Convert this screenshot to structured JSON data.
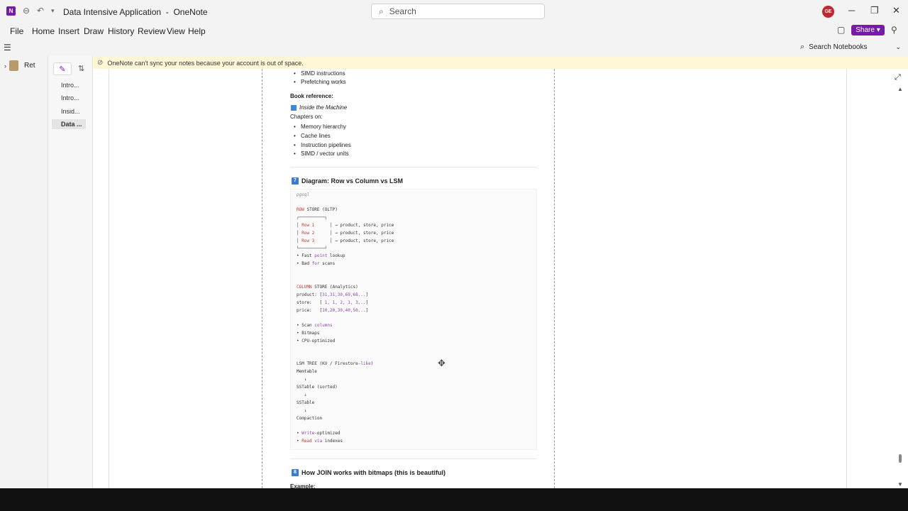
{
  "window": {
    "title": "Data Intensive Application",
    "app_name": "OneNote",
    "title_separator": "-",
    "search_placeholder": "Search",
    "avatar_initials": "GE"
  },
  "menu": {
    "items": [
      "File",
      "Home",
      "Insert",
      "Draw",
      "History",
      "Review",
      "View",
      "Help"
    ],
    "share_label": "Share"
  },
  "subbar": {
    "search_notebooks_placeholder": "Search Notebooks"
  },
  "sidebar": {
    "notebook_label": "Ret",
    "pages": [
      "Intro...",
      "Intro...",
      "Insid...",
      "Data ..."
    ],
    "active_page_index": 3
  },
  "notification": {
    "text": "OneNote can't sync your notes because your account is out of space."
  },
  "note": {
    "top_bullets": [
      "SIMD instructions",
      "Prefetching works"
    ],
    "book_reference_label": "Book reference:",
    "book_title": "Inside the Machine",
    "chapters_label": "Chapters on:",
    "chapters": [
      "Memory hierarchy",
      "Cache lines",
      "Instruction pipelines",
      "SIMD / vector units"
    ],
    "section7_badge": "7",
    "section7_title": "Diagram: Row vs Column vs LSM",
    "code_lang": "pgsql",
    "section8_badge": "8",
    "section8_title": "How JOIN works with bitmaps (this is beautiful)",
    "example_label": "Example:"
  },
  "code": {
    "row_store_kw": "ROW",
    "row_store_title": " STORE (OLTP)",
    "box_top": "┌──────────┐",
    "rows": [
      {
        "label": "Row 1",
        "desc": "→ product, store, price"
      },
      {
        "label": "Row 2",
        "desc": "→ product, store, price"
      },
      {
        "label": "Row 3",
        "desc": "→ product, store, price"
      }
    ],
    "box_bottom": "└──────────┘",
    "row_bullet1_pre": "• Fast ",
    "row_bullet1_kw": "point",
    "row_bullet1_post": " lookup",
    "row_bullet2_pre": "• Bad ",
    "row_bullet2_kw": "for",
    "row_bullet2_post": " scans",
    "col_store_kw": "COLUMN",
    "col_store_title": " STORE (Analytics)",
    "col_product_label": "product: [",
    "col_product_vals": "31,31,30,69,68...",
    "col_store_label": "store:   [",
    "col_store_vals": " 1, 1, 2, 1, 3...",
    "col_price_label": "price:   [",
    "col_price_vals": "10,20,30,40,50...",
    "col_close": "]",
    "col_bullet1_pre": "• Scan ",
    "col_bullet1_kw": "columns",
    "col_bullet2": "• Bitmaps",
    "col_bullet3": "• CPU-optimized",
    "lsm_title_pre": "LSM TREE (KV / Firestore-",
    "lsm_title_kw": "like",
    "lsm_title_post": ")",
    "lsm_memtable": "Memtable",
    "lsm_arrow": "   ↓",
    "lsm_sstable_sorted": "SSTable (sorted)",
    "lsm_sstable": "SSTable",
    "lsm_compaction": "Compaction",
    "lsm_bullet1_pre": "• ",
    "lsm_bullet1_kw": "Write",
    "lsm_bullet1_post": "-optimized",
    "lsm_bullet2_pre": "• ",
    "lsm_bullet2_kw": "Read",
    "lsm_bullet2_mid": " via",
    "lsm_bullet2_post": " indexes"
  },
  "colors": {
    "brand": "#7719aa",
    "notification_bg": "#fff6d5",
    "avatar_bg": "#c1272d"
  }
}
